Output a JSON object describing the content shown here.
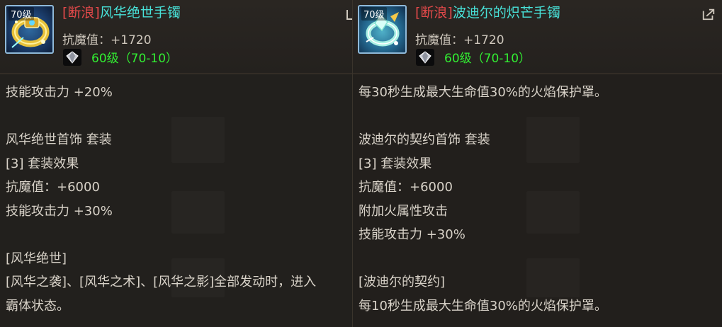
{
  "left": {
    "level_badge": "70级",
    "tag": "[断浪]",
    "name": "风华绝世手镯",
    "stat": "抗魔值：+1720",
    "level_req": "60级（70-10）",
    "lines": [
      "技能攻击力 +20%",
      "",
      "风华绝世首饰  套装",
      "[3] 套装效果",
      "抗魔值：+6000",
      "技能攻击力 +30%",
      "",
      "[风华绝世]",
      "[风华之袭]、[风华之术]、[风华之影]全部发动时，进入",
      "霸体状态。"
    ]
  },
  "right": {
    "level_badge": "70级",
    "tag": "[断浪]",
    "name": "波迪尔的炽芒手镯",
    "stat": "抗魔值：+1720",
    "level_req": "60级（70-10）",
    "lines": [
      "每30秒生成最大生命值30%的火焰保护罩。",
      "",
      "波迪尔的契约首饰  套装",
      "[3] 套装效果",
      "抗魔值：+6000",
      "附加火属性攻击",
      "技能攻击力 +30%",
      "",
      "[波迪尔的契约]",
      "每10秒生成最大生命值30%的火焰保护罩。"
    ]
  },
  "colors": {
    "tag": "#e2494a",
    "item_name": "#48e1d8",
    "level_req": "#32ef32",
    "body_text": "#d8d2c8"
  },
  "icons": {
    "left_item": "golden-bracelet-icon",
    "right_item": "crystal-bracelet-icon",
    "gem": "diamond-icon",
    "share": "share-arrow-icon"
  }
}
